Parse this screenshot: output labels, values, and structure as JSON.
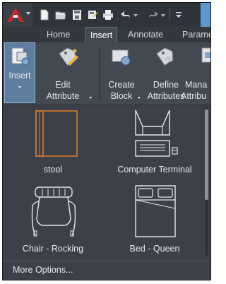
{
  "quick_access": {
    "icons": [
      "new-icon",
      "open-icon",
      "save-icon",
      "save-as-icon",
      "print-icon",
      "undo-icon",
      "redo-icon",
      "customize-icon"
    ]
  },
  "tabs": [
    "Home",
    "Insert",
    "Annotate",
    "Parame"
  ],
  "active_tab": "Insert",
  "ribbon": {
    "insert": "Insert",
    "edit_attribute": [
      "Edit",
      "Attribute"
    ],
    "create_block": [
      "Create",
      "Block"
    ],
    "define_attributes": [
      "Define",
      "Attributes"
    ],
    "manage_attributes": [
      "Mana",
      "Attribu"
    ]
  },
  "gallery": {
    "items": [
      "stool",
      "Computer Terminal",
      "Chair - Rocking",
      "Bed - Queen"
    ],
    "selected_color": "#d87a2c"
  },
  "more_options": "More Options...",
  "colors": {
    "accent": "#5a98cf",
    "brand_red": "#c7262b",
    "panel": "#3c4149"
  }
}
